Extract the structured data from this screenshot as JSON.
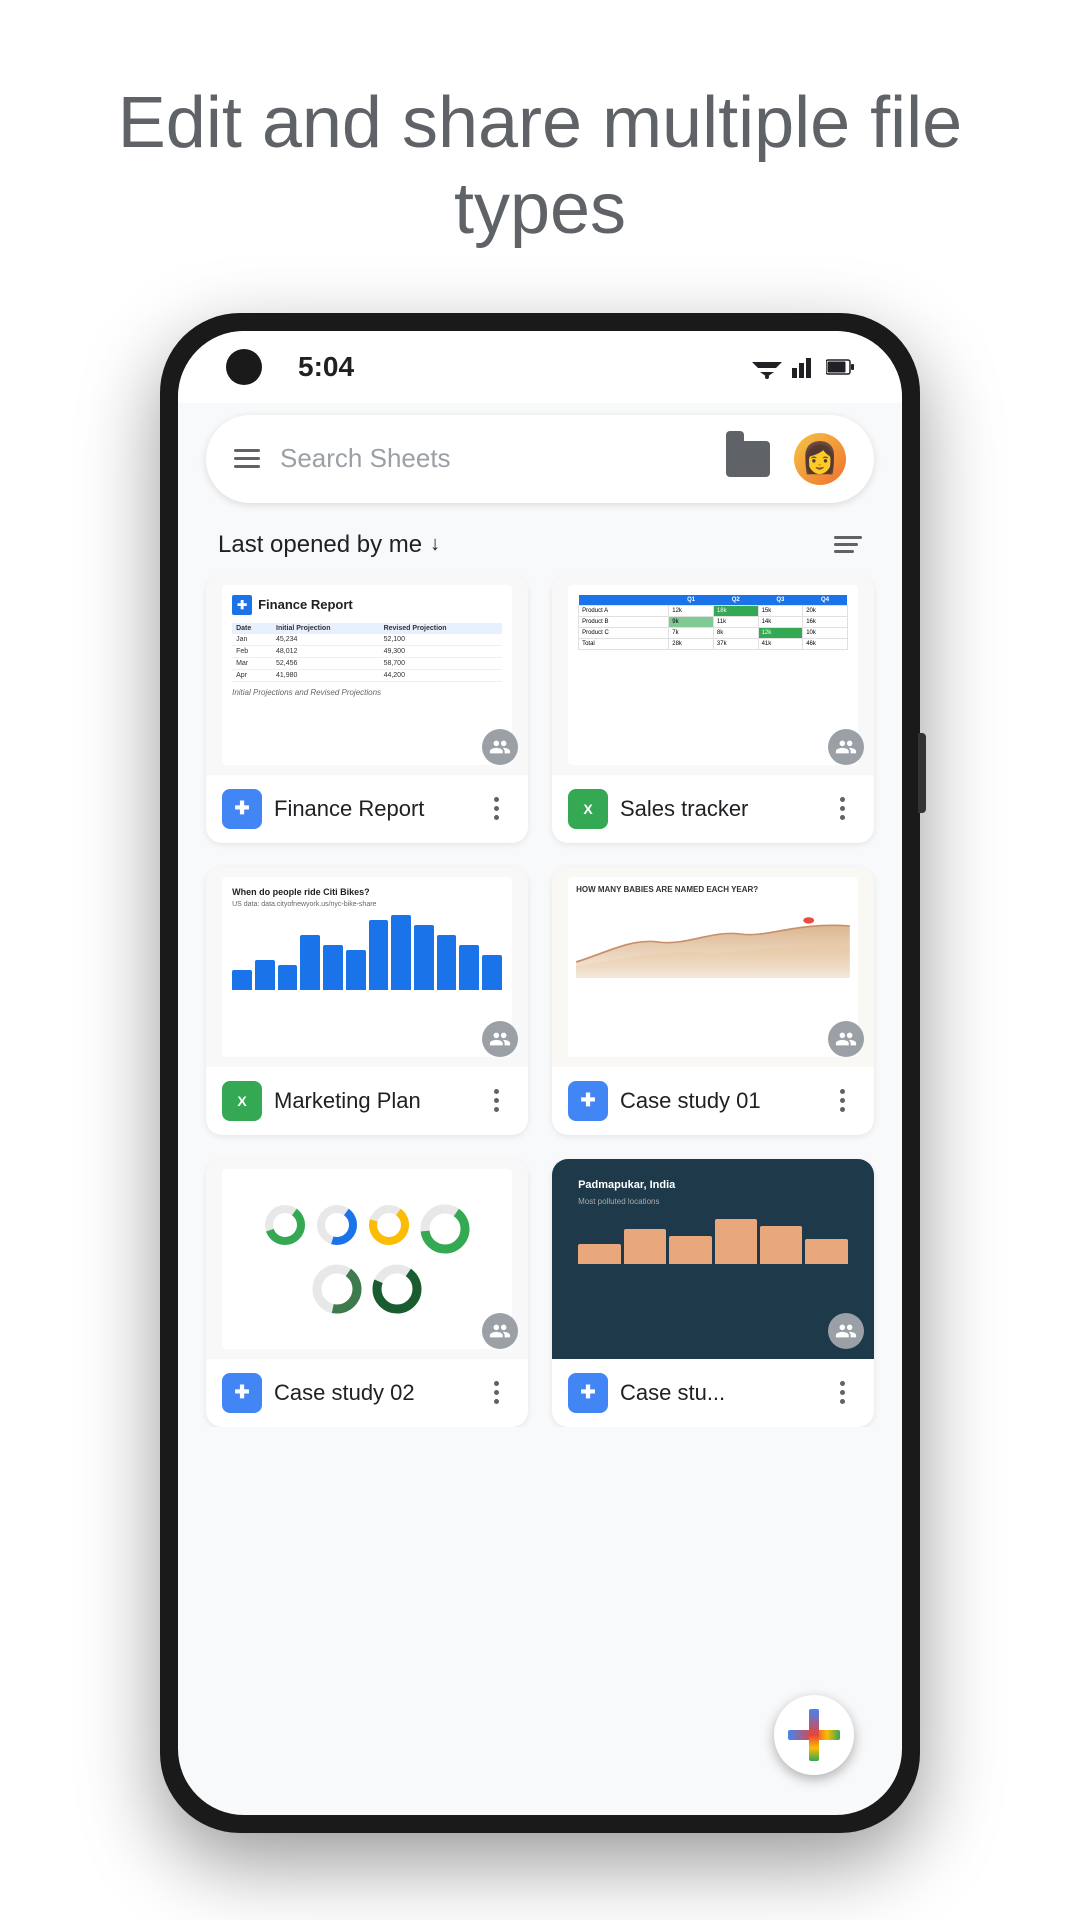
{
  "hero": {
    "title": "Edit and share multiple file types"
  },
  "status_bar": {
    "time": "5:04"
  },
  "search": {
    "placeholder": "Search Sheets"
  },
  "sort": {
    "label": "Last opened by me",
    "arrow": "↓"
  },
  "files": [
    {
      "id": "finance-report",
      "name": "Finance Report",
      "type": "sheets",
      "badge_letter": "✚",
      "thumb_type": "finance"
    },
    {
      "id": "sales-tracker",
      "name": "Sales tracker",
      "type": "sheets",
      "badge_letter": "✕",
      "thumb_type": "sales"
    },
    {
      "id": "marketing-plan",
      "name": "Marketing Plan",
      "type": "sheets",
      "badge_letter": "✕",
      "thumb_type": "marketing"
    },
    {
      "id": "case-study-01",
      "name": "Case study 01",
      "type": "docs",
      "badge_letter": "✚",
      "thumb_type": "casestudy01"
    },
    {
      "id": "case-study-02",
      "name": "Case study 02",
      "type": "docs",
      "badge_letter": "✚",
      "thumb_type": "casestudy02"
    },
    {
      "id": "case-study-03",
      "name": "Case stu...",
      "type": "docs",
      "badge_letter": "✚",
      "thumb_type": "casestudy03"
    }
  ],
  "icons": {
    "more_vert": "⋮"
  }
}
